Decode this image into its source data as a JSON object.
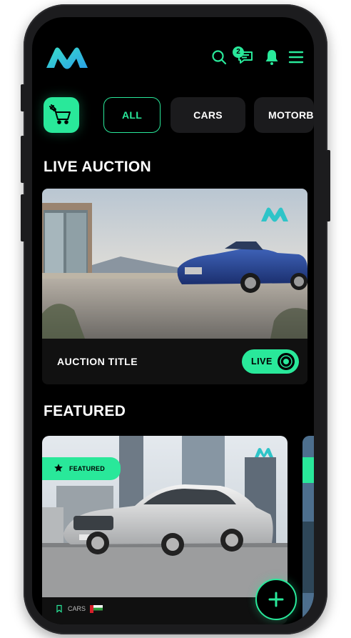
{
  "header": {
    "logo_icon": "m-logo-icon",
    "message_badge_count": "2",
    "icons": [
      "search-icon",
      "chat-icon",
      "bell-icon",
      "menu-icon"
    ]
  },
  "categories": {
    "cart_icon": "auction-cart-icon",
    "items": [
      "ALL",
      "CARS",
      "MOTORBIKES"
    ],
    "selected": "ALL"
  },
  "live_auction": {
    "section_title": "LIVE AUCTION",
    "card_title": "AUCTION TITLE",
    "status_label": "LIVE"
  },
  "featured": {
    "section_title": "FEATURED",
    "badge_label": "FEATURED",
    "category": "CARS"
  },
  "colors": {
    "accent": "#29e89a",
    "background": "#000000",
    "card": "#111111"
  },
  "fab": {
    "icon": "plus-icon"
  }
}
